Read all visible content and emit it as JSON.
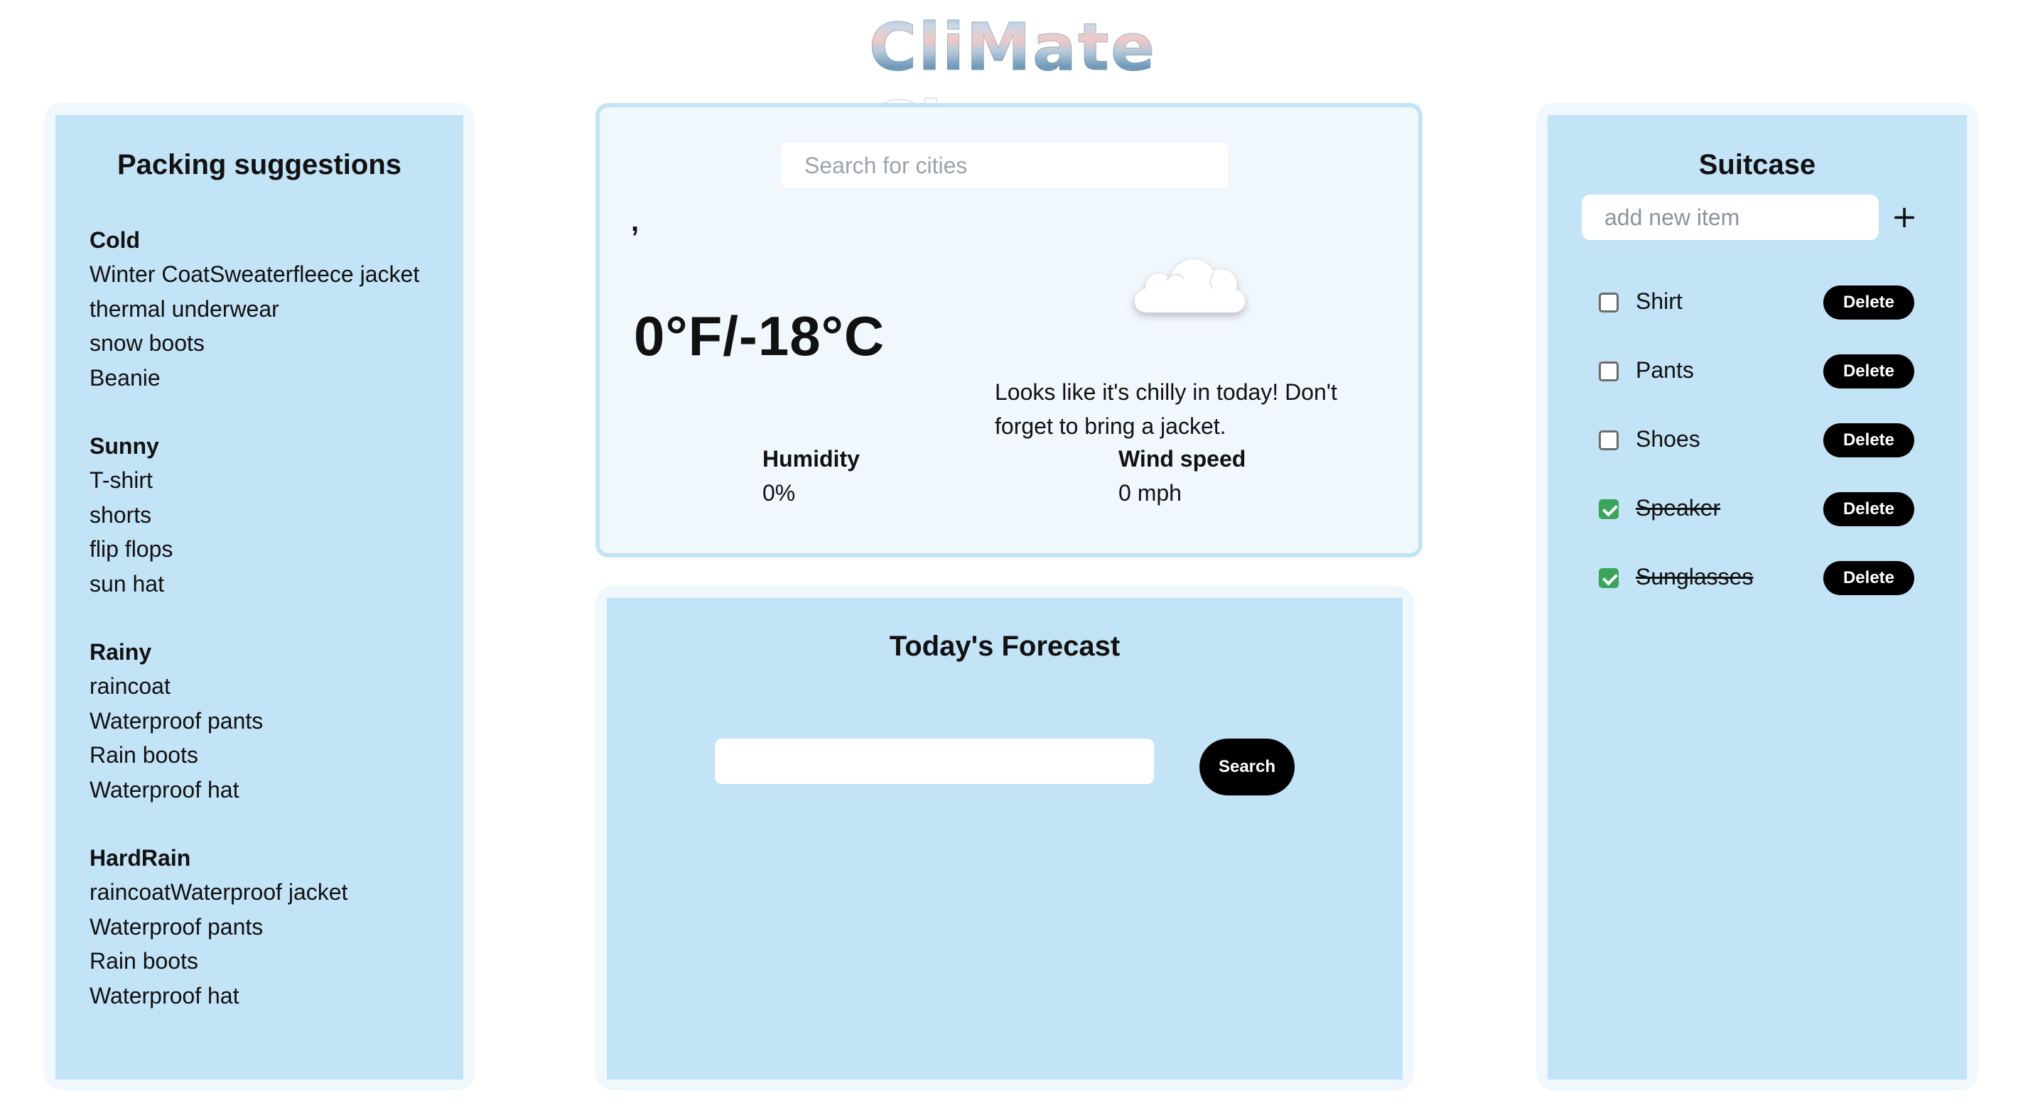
{
  "header": {
    "title": "CliMate Change"
  },
  "packing": {
    "title": "Packing suggestions",
    "groups": [
      {
        "name": "Cold",
        "items": [
          "Winter CoatSweaterfleece jacket",
          "thermal underwear",
          "snow boots",
          "Beanie"
        ]
      },
      {
        "name": "Sunny",
        "items": [
          "T-shirt",
          "shorts",
          "flip flops",
          "sun hat"
        ]
      },
      {
        "name": "Rainy",
        "items": [
          "raincoat",
          "Waterproof pants",
          "Rain boots",
          "Waterproof hat"
        ]
      },
      {
        "name": "HardRain",
        "items": [
          "raincoatWaterproof jacket",
          "Waterproof pants",
          "Rain boots",
          "Waterproof hat"
        ]
      }
    ]
  },
  "weather": {
    "search_placeholder": "Search for cities",
    "city": ",",
    "temperature": "0°F/-18°C",
    "icon": "cloud-icon",
    "message": "Looks like it's chilly in today! Don't forget to bring a jacket.",
    "humidity_label": "Humidity",
    "humidity_value": "0%",
    "wind_label": "Wind speed",
    "wind_value": "0 mph"
  },
  "forecast": {
    "title": "Today's Forecast",
    "input_value": "",
    "button_label": "Search"
  },
  "suitcase": {
    "title": "Suitcase",
    "add_placeholder": "add new item",
    "add_label": "+",
    "delete_label": "Delete",
    "items": [
      {
        "label": "Shirt",
        "checked": false
      },
      {
        "label": "Pants",
        "checked": false
      },
      {
        "label": "Shoes",
        "checked": false
      },
      {
        "label": "Speaker",
        "checked": true
      },
      {
        "label": "Sunglasses",
        "checked": true
      }
    ]
  },
  "colors": {
    "panel": "#c3e3f7",
    "panel_frame": "#f0f7fd",
    "button": "#000000",
    "check": "#3aa45b"
  }
}
